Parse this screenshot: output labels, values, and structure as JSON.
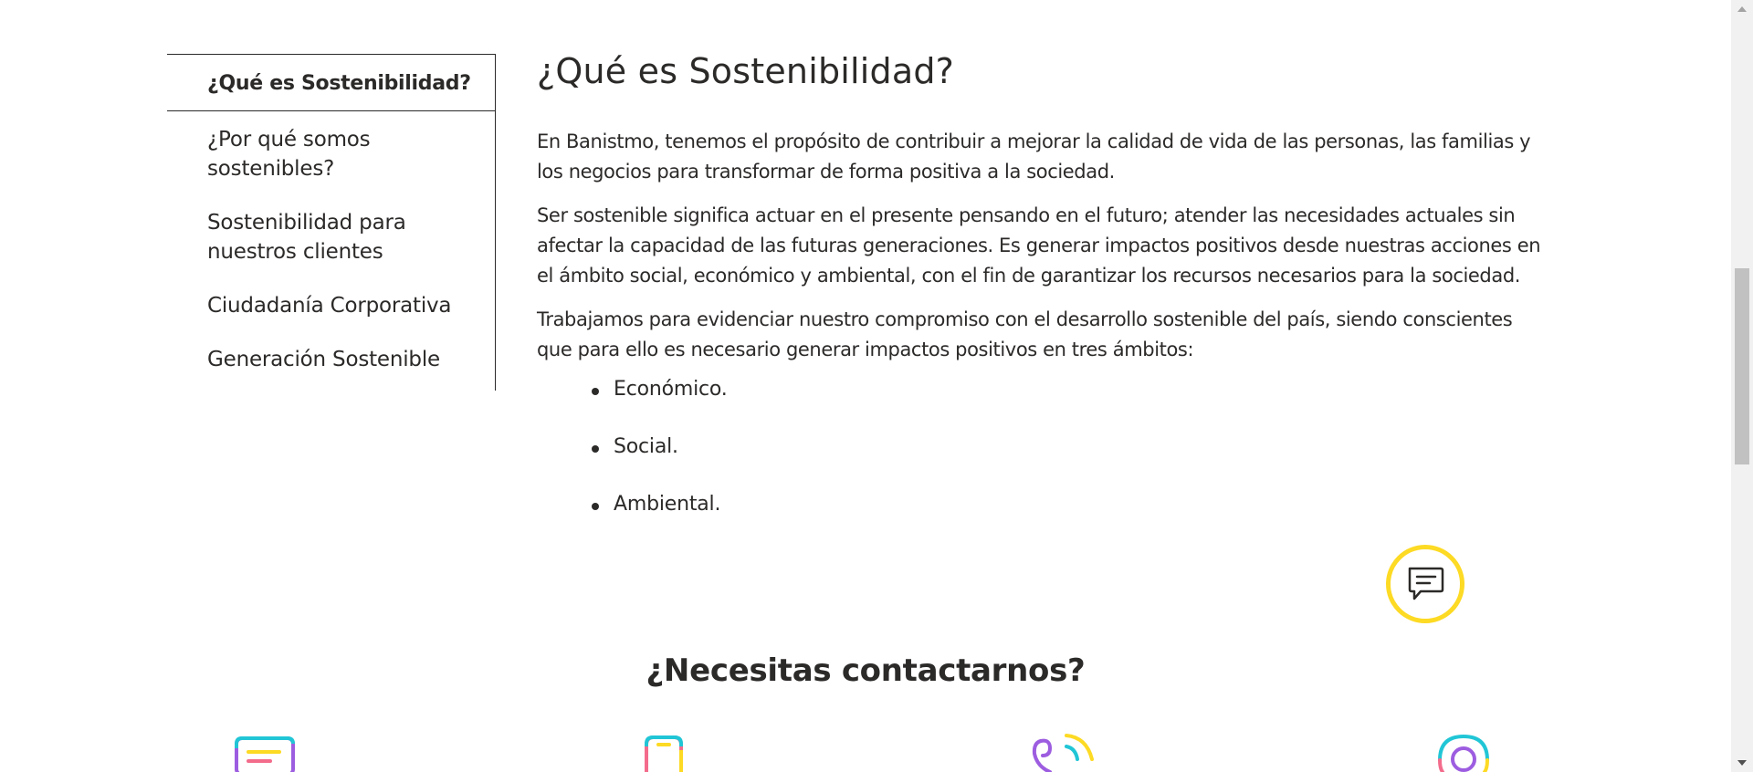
{
  "sidebar": {
    "active_item": "¿Qué es Sostenibilidad?",
    "items": [
      {
        "label": "¿Por qué somos sostenibles?"
      },
      {
        "label": "Sostenibilidad para nuestros clientes"
      },
      {
        "label": "Ciudadanía Corporativa"
      },
      {
        "label": "Generación Sostenible"
      }
    ]
  },
  "main": {
    "title": "¿Qué es Sostenibilidad?",
    "paragraphs": [
      "En Banistmo, tenemos el propósito de contribuir a mejorar la calidad de vida de las personas, las familias y los negocios para transformar de forma positiva a la sociedad.",
      "Ser sostenible significa actuar en el presente pensando en el futuro; atender las necesidades actuales sin afectar la capacidad de las futuras generaciones. Es generar impactos positivos desde nuestras acciones en el ámbito social, económico y ambiental, con el fin de garantizar los recursos necesarios para la sociedad.",
      "Trabajamos para evidenciar nuestro compromiso con el desarrollo sostenible del país, siendo conscientes que para ello es necesario generar impactos positivos en tres ámbitos:"
    ],
    "bullets": [
      "Económico.",
      "Social.",
      "Ambiental."
    ]
  },
  "chat": {
    "icon": "chat-bubble-icon",
    "ring_color": "#fdda24"
  },
  "contact": {
    "title": "¿Necesitas contactarnos?",
    "icons": [
      "form-icon",
      "mobile-phone-icon",
      "phone-call-icon",
      "location-pin-icon"
    ]
  },
  "colors": {
    "text": "#2c2a29",
    "accent_yellow": "#fdda24",
    "accent_purple": "#9d5de0",
    "accent_cyan": "#21c6d6",
    "accent_pink": "#f36c8c"
  }
}
